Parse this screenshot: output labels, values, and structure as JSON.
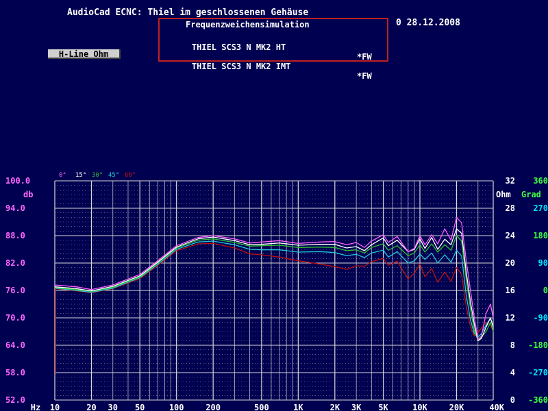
{
  "window": {
    "title": "AudioCad ECNC: Thiel im geschlossenen Gehäuse",
    "date": "0 28.12.2008"
  },
  "simulation_box": {
    "heading": "Frequenzweichensimulation",
    "rows": [
      {
        "name": "THIEL SCS3 N MK2 HT",
        "tag": "*FW"
      },
      {
        "name": "THIEL SCS3 N MK2 IMT",
        "tag": "*FW"
      }
    ]
  },
  "toolbar": {
    "hline_label": "H-Line Ohm"
  },
  "colors": {
    "background": "#000050",
    "grid": "#d8d8d8",
    "magenta_axis": "#ff66ff",
    "cyan_axis": "#00e8ff",
    "green_axis": "#40ff40",
    "white_axis": "#ffffff"
  },
  "chart_data": {
    "type": "line",
    "x_scale": "log",
    "xlim": [
      10,
      40000
    ],
    "ylim": [
      52,
      100
    ],
    "y_unit": "db",
    "y_ticks": [
      "100.0",
      "94.0",
      "88.0",
      "82.0",
      "76.0",
      "70.0",
      "64.0",
      "58.0",
      "52.0"
    ],
    "y_tick_values": [
      100,
      94,
      88,
      82,
      76,
      70,
      64,
      58,
      52
    ],
    "x_tick_labels": [
      {
        "label": "Hz",
        "value": 7
      },
      {
        "label": "10",
        "value": 10
      },
      {
        "label": "20",
        "value": 20
      },
      {
        "label": "30",
        "value": 30
      },
      {
        "label": "50",
        "value": 50
      },
      {
        "label": "100",
        "value": 100
      },
      {
        "label": "200",
        "value": 200
      },
      {
        "label": "500",
        "value": 500
      },
      {
        "label": "1K",
        "value": 1000
      },
      {
        "label": "2K",
        "value": 2000
      },
      {
        "label": "3K",
        "value": 3000
      },
      {
        "label": "5K",
        "value": 5000
      },
      {
        "label": "10K",
        "value": 10000
      },
      {
        "label": "20K",
        "value": 20000
      },
      {
        "label": "40K",
        "value": 40000
      }
    ],
    "ohm_axis": {
      "label": "Ohm",
      "ticks": [
        "32",
        "28",
        "24",
        "20",
        "16",
        "12",
        "8",
        "4",
        "0"
      ]
    },
    "grad_axis": {
      "label": "Grad",
      "ticks": [
        "360",
        "270",
        "180",
        "90",
        "0",
        "-90",
        "-180",
        "-270",
        "-360"
      ]
    },
    "legend": [
      {
        "label": "0°",
        "color": "#ff60ff"
      },
      {
        "label": "15°",
        "color": "#ffffff"
      },
      {
        "label": "30°",
        "color": "#30c030"
      },
      {
        "label": "45°",
        "color": "#20c8d8"
      },
      {
        "label": "60°",
        "color": "#c01010"
      }
    ],
    "series": [
      {
        "name": "0°",
        "color": "#ff60ff",
        "points": [
          [
            10,
            77.2
          ],
          [
            15,
            76.8
          ],
          [
            20,
            76.2
          ],
          [
            30,
            77.2
          ],
          [
            50,
            79.5
          ],
          [
            70,
            82.5
          ],
          [
            100,
            85.8
          ],
          [
            150,
            87.6
          ],
          [
            200,
            88.0
          ],
          [
            300,
            87.3
          ],
          [
            400,
            86.4
          ],
          [
            500,
            86.6
          ],
          [
            700,
            86.9
          ],
          [
            1000,
            86.3
          ],
          [
            1500,
            86.6
          ],
          [
            2000,
            86.7
          ],
          [
            2500,
            86.0
          ],
          [
            3000,
            86.5
          ],
          [
            3500,
            85.4
          ],
          [
            4000,
            86.8
          ],
          [
            5000,
            88.2
          ],
          [
            5500,
            86.5
          ],
          [
            6500,
            87.8
          ],
          [
            8000,
            84.5
          ],
          [
            9000,
            85.2
          ],
          [
            10000,
            88.0
          ],
          [
            11000,
            86.0
          ],
          [
            12500,
            88.2
          ],
          [
            14000,
            86.2
          ],
          [
            16000,
            89.5
          ],
          [
            18000,
            87.0
          ],
          [
            20000,
            92.0
          ],
          [
            22000,
            90.8
          ],
          [
            24000,
            82.5
          ],
          [
            26000,
            76.0
          ],
          [
            28000,
            70.0
          ],
          [
            30000,
            65.3
          ],
          [
            32000,
            66.0
          ],
          [
            35000,
            71.0
          ],
          [
            38000,
            73.0
          ],
          [
            40000,
            70.0
          ]
        ]
      },
      {
        "name": "15°",
        "color": "#ffffff",
        "points": [
          [
            10,
            76.8
          ],
          [
            15,
            76.4
          ],
          [
            20,
            75.9
          ],
          [
            30,
            76.9
          ],
          [
            50,
            79.2
          ],
          [
            70,
            82.2
          ],
          [
            100,
            85.5
          ],
          [
            150,
            87.3
          ],
          [
            200,
            87.7
          ],
          [
            300,
            86.9
          ],
          [
            400,
            86.0
          ],
          [
            500,
            86.1
          ],
          [
            700,
            86.4
          ],
          [
            1000,
            85.9
          ],
          [
            1500,
            86.1
          ],
          [
            2000,
            86.1
          ],
          [
            2500,
            85.3
          ],
          [
            3000,
            85.6
          ],
          [
            3500,
            84.7
          ],
          [
            4000,
            86.0
          ],
          [
            5000,
            87.5
          ],
          [
            5500,
            85.8
          ],
          [
            6500,
            87.0
          ],
          [
            8000,
            84.5
          ],
          [
            9000,
            85.0
          ],
          [
            10000,
            87.3
          ],
          [
            11000,
            85.2
          ],
          [
            12500,
            87.6
          ],
          [
            14000,
            85.0
          ],
          [
            16000,
            87.2
          ],
          [
            18000,
            86.0
          ],
          [
            20000,
            89.5
          ],
          [
            22000,
            88.5
          ],
          [
            24000,
            80.0
          ],
          [
            26000,
            73.5
          ],
          [
            28000,
            68.5
          ],
          [
            30000,
            65.0
          ],
          [
            32000,
            65.5
          ],
          [
            35000,
            68.0
          ],
          [
            38000,
            70.0
          ],
          [
            40000,
            68.0
          ]
        ]
      },
      {
        "name": "30°",
        "color": "#30c030",
        "points": [
          [
            10,
            76.6
          ],
          [
            15,
            76.2
          ],
          [
            20,
            75.8
          ],
          [
            30,
            76.7
          ],
          [
            50,
            79.0
          ],
          [
            70,
            82.0
          ],
          [
            100,
            85.3
          ],
          [
            150,
            87.0
          ],
          [
            200,
            87.3
          ],
          [
            300,
            86.5
          ],
          [
            400,
            85.7
          ],
          [
            500,
            85.8
          ],
          [
            700,
            85.9
          ],
          [
            1000,
            85.4
          ],
          [
            1500,
            85.5
          ],
          [
            2000,
            85.4
          ],
          [
            2500,
            84.7
          ],
          [
            3000,
            84.9
          ],
          [
            3500,
            84.2
          ],
          [
            4000,
            85.4
          ],
          [
            5000,
            86.2
          ],
          [
            5500,
            84.8
          ],
          [
            6500,
            85.8
          ],
          [
            8000,
            83.6
          ],
          [
            9000,
            84.2
          ],
          [
            10000,
            86.0
          ],
          [
            11000,
            84.4
          ],
          [
            12500,
            86.2
          ],
          [
            14000,
            84.4
          ],
          [
            16000,
            86.0
          ],
          [
            18000,
            84.8
          ],
          [
            20000,
            88.0
          ],
          [
            22000,
            86.8
          ],
          [
            24000,
            78.5
          ],
          [
            26000,
            72.0
          ],
          [
            28000,
            67.2
          ],
          [
            30000,
            65.0
          ],
          [
            32000,
            65.8
          ],
          [
            35000,
            67.0
          ],
          [
            38000,
            69.0
          ],
          [
            40000,
            67.0
          ]
        ]
      },
      {
        "name": "45°",
        "color": "#20c8d8",
        "points": [
          [
            10,
            76.5
          ],
          [
            15,
            76.0
          ],
          [
            20,
            75.6
          ],
          [
            30,
            76.5
          ],
          [
            50,
            78.8
          ],
          [
            70,
            81.7
          ],
          [
            100,
            85.0
          ],
          [
            150,
            86.6
          ],
          [
            200,
            86.8
          ],
          [
            300,
            86.0
          ],
          [
            400,
            85.0
          ],
          [
            500,
            84.9
          ],
          [
            700,
            84.9
          ],
          [
            1000,
            84.4
          ],
          [
            1500,
            84.5
          ],
          [
            2000,
            84.3
          ],
          [
            2500,
            83.6
          ],
          [
            3000,
            83.9
          ],
          [
            3500,
            83.2
          ],
          [
            4000,
            84.2
          ],
          [
            5000,
            84.8
          ],
          [
            5500,
            83.3
          ],
          [
            6500,
            84.5
          ],
          [
            8000,
            82.0
          ],
          [
            9000,
            82.5
          ],
          [
            10000,
            84.0
          ],
          [
            11000,
            82.8
          ],
          [
            12500,
            84.2
          ],
          [
            14000,
            82.0
          ],
          [
            16000,
            83.8
          ],
          [
            18000,
            82.2
          ],
          [
            20000,
            84.8
          ],
          [
            22000,
            83.5
          ],
          [
            24000,
            75.0
          ],
          [
            26000,
            69.5
          ],
          [
            28000,
            66.5
          ],
          [
            30000,
            65.8
          ],
          [
            32000,
            66.5
          ],
          [
            35000,
            68.5
          ],
          [
            38000,
            69.8
          ],
          [
            40000,
            68.0
          ]
        ]
      },
      {
        "name": "60°",
        "color": "#c01010",
        "points": [
          [
            10,
            76.4
          ],
          [
            15,
            75.9
          ],
          [
            20,
            75.5
          ],
          [
            30,
            76.4
          ],
          [
            50,
            78.6
          ],
          [
            70,
            81.5
          ],
          [
            100,
            84.7
          ],
          [
            150,
            86.2
          ],
          [
            200,
            86.3
          ],
          [
            300,
            85.3
          ],
          [
            400,
            84.0
          ],
          [
            500,
            83.8
          ],
          [
            700,
            83.3
          ],
          [
            1000,
            82.5
          ],
          [
            1500,
            81.8
          ],
          [
            2000,
            81.2
          ],
          [
            2500,
            80.6
          ],
          [
            3000,
            81.4
          ],
          [
            3500,
            81.3
          ],
          [
            4000,
            82.3
          ],
          [
            5000,
            83.0
          ],
          [
            5500,
            81.5
          ],
          [
            6500,
            82.4
          ],
          [
            8000,
            78.5
          ],
          [
            9000,
            79.8
          ],
          [
            10000,
            81.8
          ],
          [
            11000,
            79.0
          ],
          [
            12500,
            80.8
          ],
          [
            14000,
            77.8
          ],
          [
            16000,
            80.0
          ],
          [
            18000,
            78.0
          ],
          [
            20000,
            81.0
          ],
          [
            22000,
            79.5
          ],
          [
            24000,
            72.5
          ],
          [
            26000,
            68.0
          ],
          [
            28000,
            66.0
          ],
          [
            30000,
            66.8
          ],
          [
            32000,
            67.8
          ],
          [
            35000,
            69.0
          ],
          [
            38000,
            68.5
          ],
          [
            40000,
            67.0
          ]
        ]
      }
    ]
  }
}
